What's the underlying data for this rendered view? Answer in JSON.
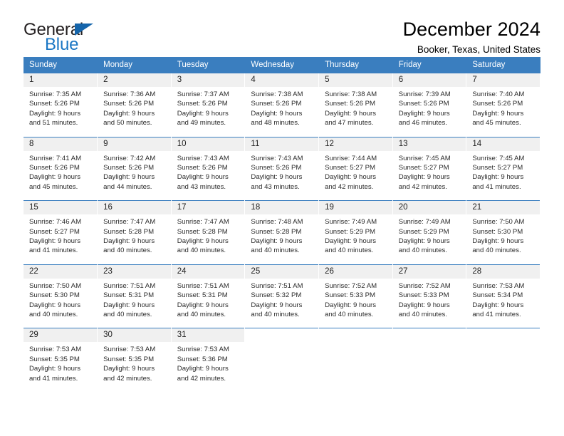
{
  "brand": {
    "name_part1": "General",
    "name_part2": "Blue",
    "triangle_color": "#1565ab",
    "blue_color": "#1a76c4"
  },
  "header": {
    "title": "December 2024",
    "subtitle": "Booker, Texas, United States"
  },
  "theme": {
    "header_bg": "#3a7ebf",
    "daynum_bg": "#f0f0f0",
    "cell_bg": "#ffffff",
    "text": "#2b2b2b"
  },
  "weekdays": [
    "Sunday",
    "Monday",
    "Tuesday",
    "Wednesday",
    "Thursday",
    "Friday",
    "Saturday"
  ],
  "weeks": [
    [
      {
        "day": "1",
        "sunrise": "Sunrise: 7:35 AM",
        "sunset": "Sunset: 5:26 PM",
        "daylight1": "Daylight: 9 hours",
        "daylight2": "and 51 minutes."
      },
      {
        "day": "2",
        "sunrise": "Sunrise: 7:36 AM",
        "sunset": "Sunset: 5:26 PM",
        "daylight1": "Daylight: 9 hours",
        "daylight2": "and 50 minutes."
      },
      {
        "day": "3",
        "sunrise": "Sunrise: 7:37 AM",
        "sunset": "Sunset: 5:26 PM",
        "daylight1": "Daylight: 9 hours",
        "daylight2": "and 49 minutes."
      },
      {
        "day": "4",
        "sunrise": "Sunrise: 7:38 AM",
        "sunset": "Sunset: 5:26 PM",
        "daylight1": "Daylight: 9 hours",
        "daylight2": "and 48 minutes."
      },
      {
        "day": "5",
        "sunrise": "Sunrise: 7:38 AM",
        "sunset": "Sunset: 5:26 PM",
        "daylight1": "Daylight: 9 hours",
        "daylight2": "and 47 minutes."
      },
      {
        "day": "6",
        "sunrise": "Sunrise: 7:39 AM",
        "sunset": "Sunset: 5:26 PM",
        "daylight1": "Daylight: 9 hours",
        "daylight2": "and 46 minutes."
      },
      {
        "day": "7",
        "sunrise": "Sunrise: 7:40 AM",
        "sunset": "Sunset: 5:26 PM",
        "daylight1": "Daylight: 9 hours",
        "daylight2": "and 45 minutes."
      }
    ],
    [
      {
        "day": "8",
        "sunrise": "Sunrise: 7:41 AM",
        "sunset": "Sunset: 5:26 PM",
        "daylight1": "Daylight: 9 hours",
        "daylight2": "and 45 minutes."
      },
      {
        "day": "9",
        "sunrise": "Sunrise: 7:42 AM",
        "sunset": "Sunset: 5:26 PM",
        "daylight1": "Daylight: 9 hours",
        "daylight2": "and 44 minutes."
      },
      {
        "day": "10",
        "sunrise": "Sunrise: 7:43 AM",
        "sunset": "Sunset: 5:26 PM",
        "daylight1": "Daylight: 9 hours",
        "daylight2": "and 43 minutes."
      },
      {
        "day": "11",
        "sunrise": "Sunrise: 7:43 AM",
        "sunset": "Sunset: 5:26 PM",
        "daylight1": "Daylight: 9 hours",
        "daylight2": "and 43 minutes."
      },
      {
        "day": "12",
        "sunrise": "Sunrise: 7:44 AM",
        "sunset": "Sunset: 5:27 PM",
        "daylight1": "Daylight: 9 hours",
        "daylight2": "and 42 minutes."
      },
      {
        "day": "13",
        "sunrise": "Sunrise: 7:45 AM",
        "sunset": "Sunset: 5:27 PM",
        "daylight1": "Daylight: 9 hours",
        "daylight2": "and 42 minutes."
      },
      {
        "day": "14",
        "sunrise": "Sunrise: 7:45 AM",
        "sunset": "Sunset: 5:27 PM",
        "daylight1": "Daylight: 9 hours",
        "daylight2": "and 41 minutes."
      }
    ],
    [
      {
        "day": "15",
        "sunrise": "Sunrise: 7:46 AM",
        "sunset": "Sunset: 5:27 PM",
        "daylight1": "Daylight: 9 hours",
        "daylight2": "and 41 minutes."
      },
      {
        "day": "16",
        "sunrise": "Sunrise: 7:47 AM",
        "sunset": "Sunset: 5:28 PM",
        "daylight1": "Daylight: 9 hours",
        "daylight2": "and 40 minutes."
      },
      {
        "day": "17",
        "sunrise": "Sunrise: 7:47 AM",
        "sunset": "Sunset: 5:28 PM",
        "daylight1": "Daylight: 9 hours",
        "daylight2": "and 40 minutes."
      },
      {
        "day": "18",
        "sunrise": "Sunrise: 7:48 AM",
        "sunset": "Sunset: 5:28 PM",
        "daylight1": "Daylight: 9 hours",
        "daylight2": "and 40 minutes."
      },
      {
        "day": "19",
        "sunrise": "Sunrise: 7:49 AM",
        "sunset": "Sunset: 5:29 PM",
        "daylight1": "Daylight: 9 hours",
        "daylight2": "and 40 minutes."
      },
      {
        "day": "20",
        "sunrise": "Sunrise: 7:49 AM",
        "sunset": "Sunset: 5:29 PM",
        "daylight1": "Daylight: 9 hours",
        "daylight2": "and 40 minutes."
      },
      {
        "day": "21",
        "sunrise": "Sunrise: 7:50 AM",
        "sunset": "Sunset: 5:30 PM",
        "daylight1": "Daylight: 9 hours",
        "daylight2": "and 40 minutes."
      }
    ],
    [
      {
        "day": "22",
        "sunrise": "Sunrise: 7:50 AM",
        "sunset": "Sunset: 5:30 PM",
        "daylight1": "Daylight: 9 hours",
        "daylight2": "and 40 minutes."
      },
      {
        "day": "23",
        "sunrise": "Sunrise: 7:51 AM",
        "sunset": "Sunset: 5:31 PM",
        "daylight1": "Daylight: 9 hours",
        "daylight2": "and 40 minutes."
      },
      {
        "day": "24",
        "sunrise": "Sunrise: 7:51 AM",
        "sunset": "Sunset: 5:31 PM",
        "daylight1": "Daylight: 9 hours",
        "daylight2": "and 40 minutes."
      },
      {
        "day": "25",
        "sunrise": "Sunrise: 7:51 AM",
        "sunset": "Sunset: 5:32 PM",
        "daylight1": "Daylight: 9 hours",
        "daylight2": "and 40 minutes."
      },
      {
        "day": "26",
        "sunrise": "Sunrise: 7:52 AM",
        "sunset": "Sunset: 5:33 PM",
        "daylight1": "Daylight: 9 hours",
        "daylight2": "and 40 minutes."
      },
      {
        "day": "27",
        "sunrise": "Sunrise: 7:52 AM",
        "sunset": "Sunset: 5:33 PM",
        "daylight1": "Daylight: 9 hours",
        "daylight2": "and 40 minutes."
      },
      {
        "day": "28",
        "sunrise": "Sunrise: 7:53 AM",
        "sunset": "Sunset: 5:34 PM",
        "daylight1": "Daylight: 9 hours",
        "daylight2": "and 41 minutes."
      }
    ],
    [
      {
        "day": "29",
        "sunrise": "Sunrise: 7:53 AM",
        "sunset": "Sunset: 5:35 PM",
        "daylight1": "Daylight: 9 hours",
        "daylight2": "and 41 minutes."
      },
      {
        "day": "30",
        "sunrise": "Sunrise: 7:53 AM",
        "sunset": "Sunset: 5:35 PM",
        "daylight1": "Daylight: 9 hours",
        "daylight2": "and 42 minutes."
      },
      {
        "day": "31",
        "sunrise": "Sunrise: 7:53 AM",
        "sunset": "Sunset: 5:36 PM",
        "daylight1": "Daylight: 9 hours",
        "daylight2": "and 42 minutes."
      },
      {
        "day": "",
        "sunrise": "",
        "sunset": "",
        "daylight1": "",
        "daylight2": ""
      },
      {
        "day": "",
        "sunrise": "",
        "sunset": "",
        "daylight1": "",
        "daylight2": ""
      },
      {
        "day": "",
        "sunrise": "",
        "sunset": "",
        "daylight1": "",
        "daylight2": ""
      },
      {
        "day": "",
        "sunrise": "",
        "sunset": "",
        "daylight1": "",
        "daylight2": ""
      }
    ]
  ]
}
